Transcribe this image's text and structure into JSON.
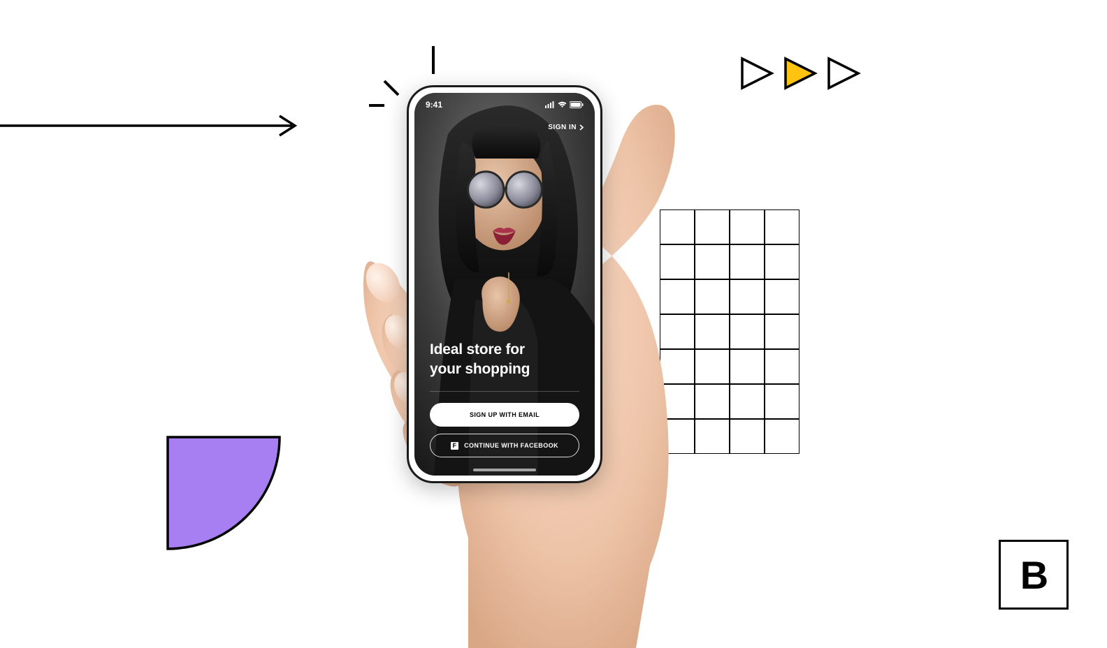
{
  "colors": {
    "accent_yellow": "#fec40f",
    "accent_purple": "#a87ff3",
    "black": "#000000",
    "white": "#ffffff"
  },
  "phone": {
    "status_time": "9:41",
    "sign_in_label": "SIGN IN",
    "headline_line1": "Ideal store for",
    "headline_line2": "your shopping",
    "signup_email_label": "SIGN UP WITH EMAIL",
    "continue_facebook_label": "CONTINUE WITH FACEBOOK"
  },
  "logo": {
    "letter": "B"
  }
}
